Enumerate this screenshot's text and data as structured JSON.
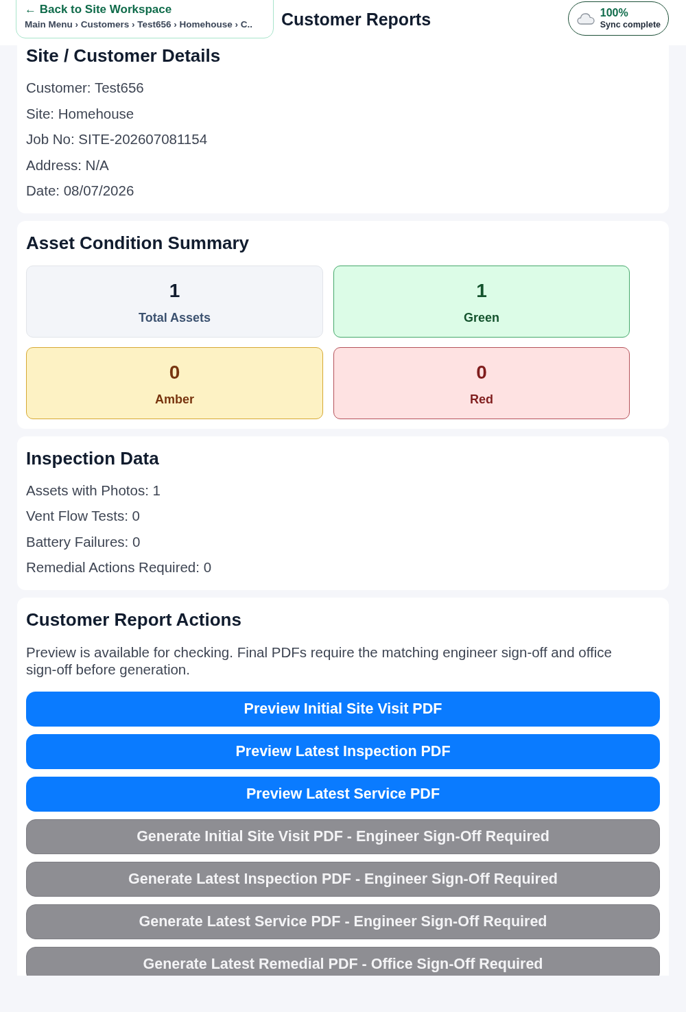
{
  "header": {
    "back_link": "← Back to Site Workspace",
    "breadcrumb": "Main Menu › Customers › Test656 › Homehouse › C..",
    "title": "Customer Reports",
    "sync": {
      "percent": "100%",
      "status": "Sync complete"
    }
  },
  "site_details": {
    "title": "Site / Customer Details",
    "lines": [
      "Customer: Test656",
      "Site: Homehouse",
      "Job No: SITE-202607081154",
      "Address: N/A",
      "Date: 08/07/2026"
    ]
  },
  "asset_summary": {
    "title": "Asset Condition Summary",
    "tiles": [
      {
        "kind": "total",
        "value": "1",
        "label": "Total Assets"
      },
      {
        "kind": "green",
        "value": "1",
        "label": "Green"
      },
      {
        "kind": "amber",
        "value": "0",
        "label": "Amber"
      },
      {
        "kind": "red",
        "value": "0",
        "label": "Red"
      }
    ]
  },
  "inspection_data": {
    "title": "Inspection Data",
    "lines": [
      "Assets with Photos: 1",
      "Vent Flow Tests: 0",
      "Battery Failures: 0",
      "Remedial Actions Required: 0"
    ]
  },
  "report_actions": {
    "title": "Customer Report Actions",
    "description": "Preview is available for checking. Final PDFs require the matching engineer sign-off and office sign-off before generation.",
    "buttons": [
      {
        "label": "Preview Initial Site Visit PDF",
        "disabled": false
      },
      {
        "label": "Preview Latest Inspection PDF",
        "disabled": false
      },
      {
        "label": "Preview Latest Service PDF",
        "disabled": false
      },
      {
        "label": "Generate Initial Site Visit PDF - Engineer Sign-Off Required",
        "disabled": true
      },
      {
        "label": "Generate Latest Inspection PDF - Engineer Sign-Off Required",
        "disabled": true
      },
      {
        "label": "Generate Latest Service PDF - Engineer Sign-Off Required",
        "disabled": true
      },
      {
        "label": "Generate Latest Remedial PDF - Office Sign-Off Required",
        "disabled": true
      }
    ]
  }
}
